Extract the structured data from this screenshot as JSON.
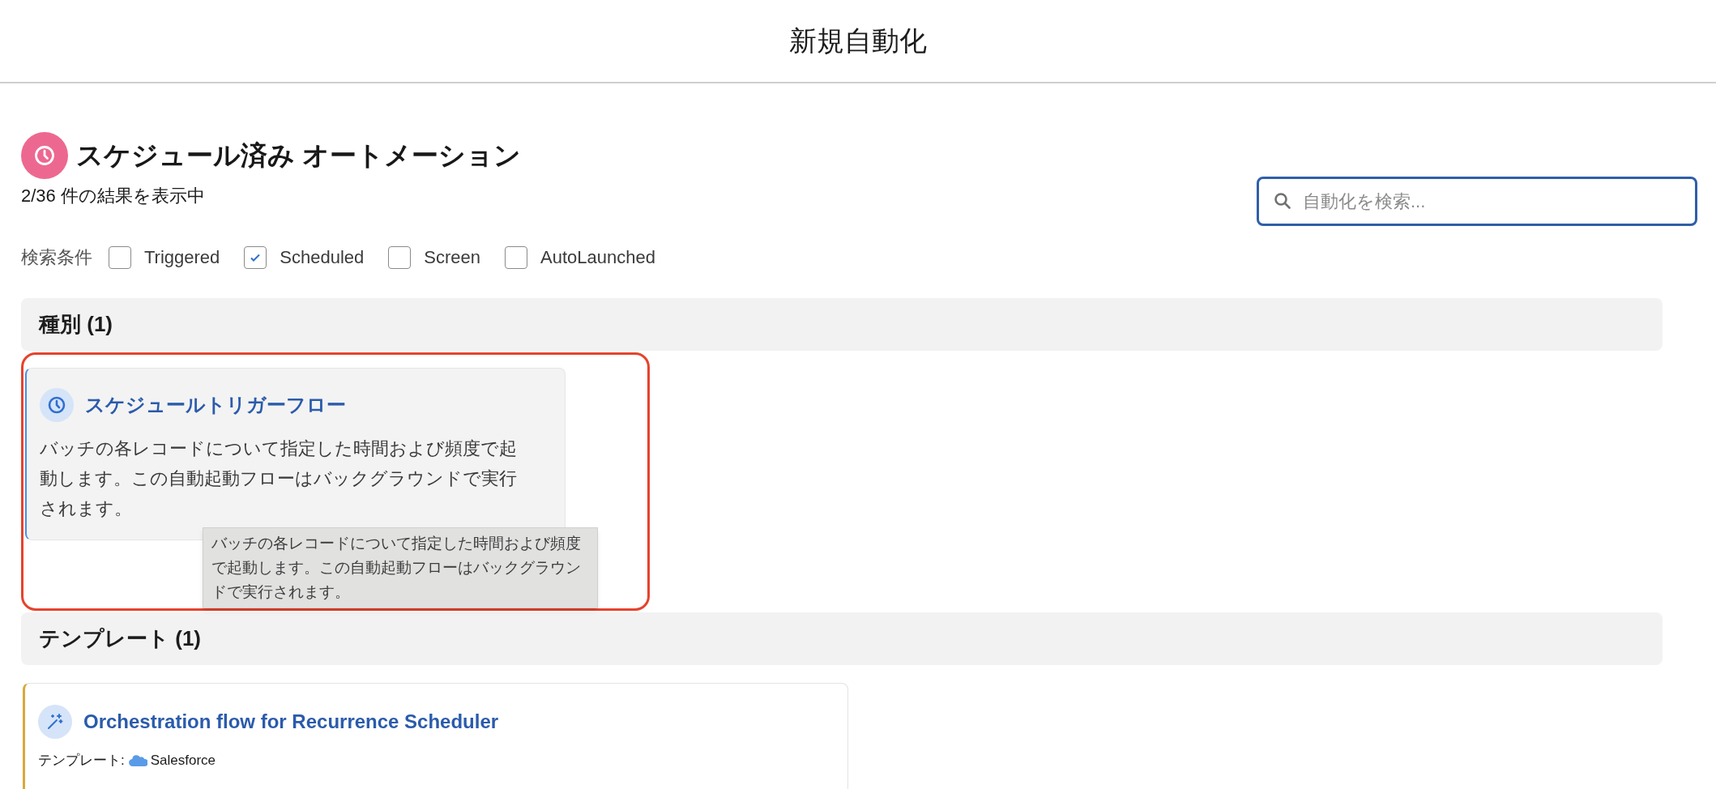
{
  "header": {
    "title": "新規自動化"
  },
  "section": {
    "title": "スケジュール済み オートメーション",
    "result_count": "2/36 件の結果を表示中"
  },
  "search": {
    "placeholder": "自動化を検索..."
  },
  "filters": {
    "label": "検索条件",
    "options": [
      {
        "label": "Triggered",
        "checked": false
      },
      {
        "label": "Scheduled",
        "checked": true
      },
      {
        "label": "Screen",
        "checked": false
      },
      {
        "label": "AutoLaunched",
        "checked": false
      }
    ]
  },
  "groups": [
    {
      "title": "種別 (1)",
      "highlighted": true,
      "cards": [
        {
          "kind": "type",
          "title": "スケジュールトリガーフロー",
          "description": "バッチの各レコードについて指定した時間および頻度で起動します。この自動起動フローはバックグラウンドで実行されます。",
          "tooltip": "バッチの各レコードについて指定した時間および頻度で起動します。この自動起動フローはバックグラウンドで実行されます。"
        }
      ]
    },
    {
      "title": "テンプレート (1)",
      "highlighted": false,
      "cards": [
        {
          "kind": "template",
          "title": "Orchestration flow for Recurrence Scheduler",
          "source_label": "テンプレート:",
          "source": "Salesforce"
        }
      ]
    }
  ]
}
